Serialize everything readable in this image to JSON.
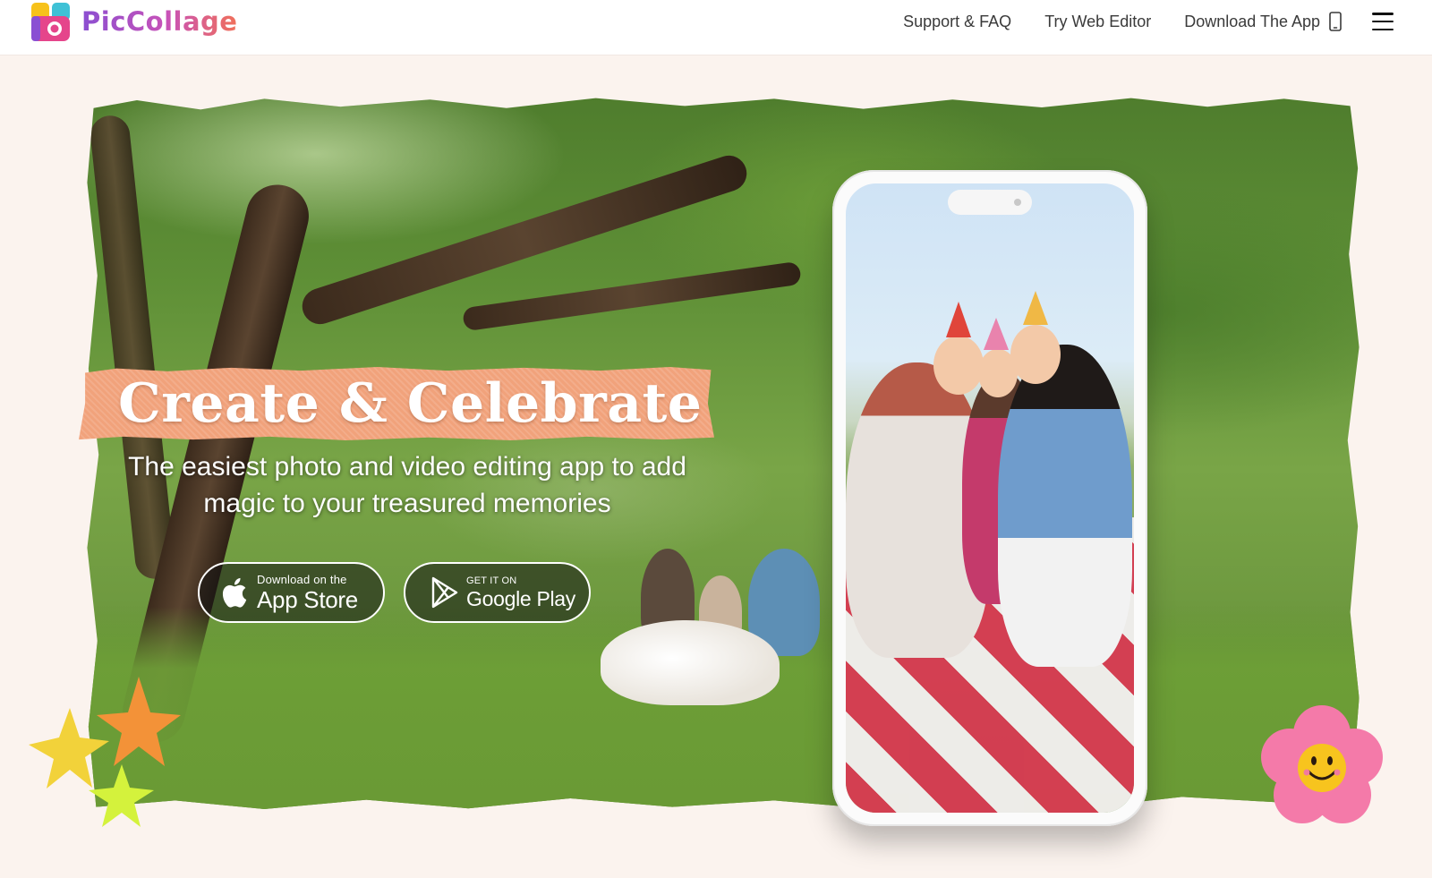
{
  "nav": {
    "brand": "PicCollage",
    "links": [
      {
        "label": "Support & FAQ"
      },
      {
        "label": "Try Web Editor"
      },
      {
        "label": "Download The App"
      }
    ]
  },
  "hero": {
    "headline": "Create & Celebrate",
    "subheadline": "The easiest photo and video editing app to add magic to your treasured memories",
    "app_store": {
      "small": "Download on the",
      "big": "App Store"
    },
    "google_play": {
      "small": "GET IT ON",
      "big": "Google Play"
    }
  },
  "colors": {
    "background": "#fbf3ee",
    "headline_banner": "#f1a27b",
    "brand_gradient_start": "#8b4fd1",
    "brand_gradient_end": "#f0705a"
  },
  "icons": [
    "piccollage-logo-icon",
    "phone-icon",
    "hamburger-menu-icon",
    "apple-icon",
    "google-play-icon",
    "star-sticker-icon",
    "flower-smiley-sticker-icon"
  ]
}
